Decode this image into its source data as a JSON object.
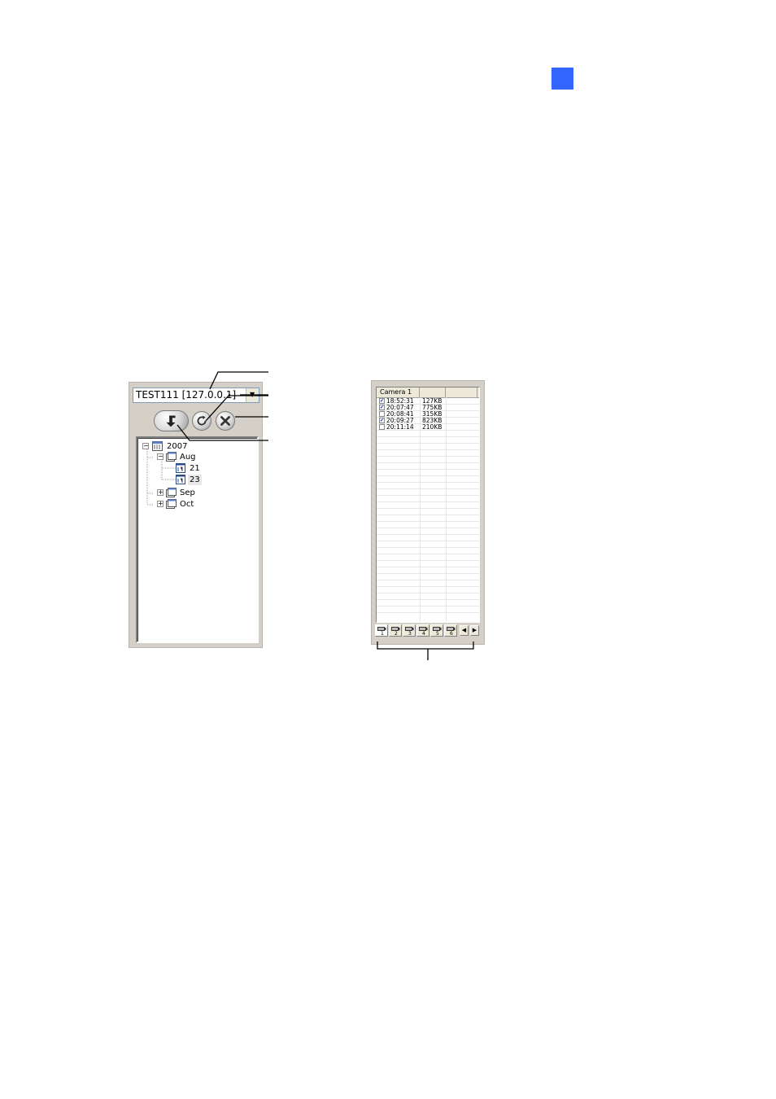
{
  "colors": {
    "page_marker": "#3366ff",
    "check": "#1a3ea8"
  },
  "server": {
    "selected": "TEST111 [127.0.0.1]"
  },
  "toolbar": {
    "download_icon": "download-arrow-icon",
    "refresh_icon": "refresh-icon",
    "cancel_icon": "close-icon"
  },
  "tree": {
    "year": "2007",
    "months": [
      {
        "label": "Aug",
        "expanded": true,
        "days": [
          "21",
          "23"
        ]
      },
      {
        "label": "Sep",
        "expanded": false
      },
      {
        "label": "Oct",
        "expanded": false
      }
    ],
    "selected_day": "23"
  },
  "file_list": {
    "columns": [
      "Camera 1",
      "",
      ""
    ],
    "rows": [
      {
        "checked": true,
        "time": "18:52:31",
        "size": "127KB"
      },
      {
        "checked": true,
        "time": "20:07:47",
        "size": "775KB"
      },
      {
        "checked": false,
        "time": "20:08:41",
        "size": "315KB"
      },
      {
        "checked": true,
        "time": "20:09:27",
        "size": "823KB"
      },
      {
        "checked": false,
        "time": "20:11:14",
        "size": "210KB"
      }
    ]
  },
  "camera_tabs": [
    "1",
    "2",
    "3",
    "4",
    "5",
    "6"
  ]
}
